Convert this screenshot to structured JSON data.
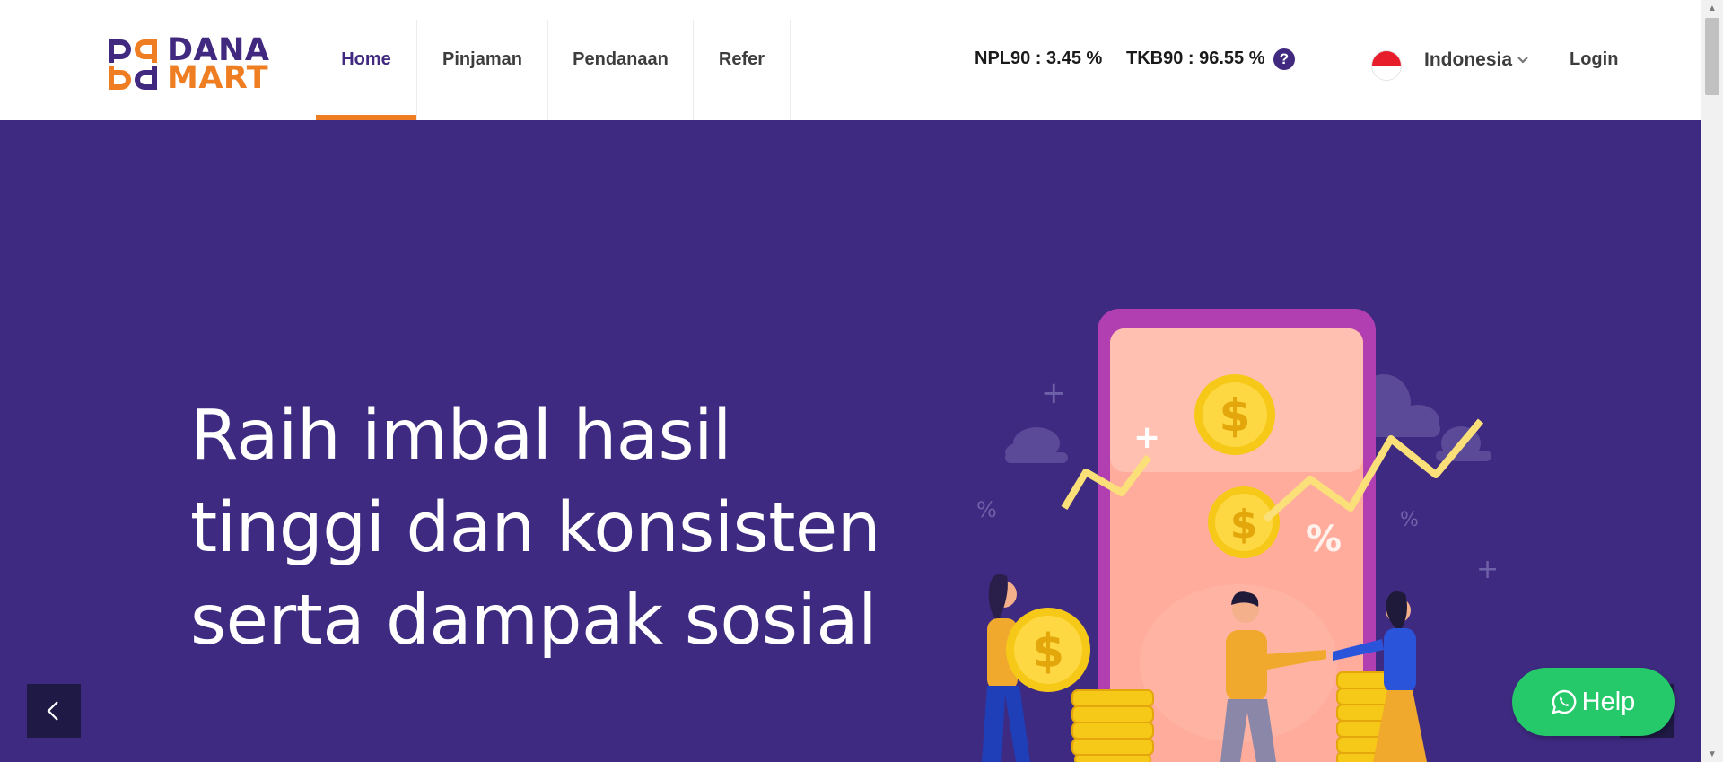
{
  "brand": {
    "name_line1": "DANA",
    "name_line2": "MART",
    "primary": "#40297f",
    "accent": "#ef7d22"
  },
  "nav": {
    "items": [
      {
        "label": "Home",
        "active": true
      },
      {
        "label": "Pinjaman",
        "active": false
      },
      {
        "label": "Pendanaan",
        "active": false
      },
      {
        "label": "Refer",
        "active": false
      }
    ]
  },
  "stats": {
    "npl": "NPL90 : 3.45 %",
    "tkb": "TKB90 : 96.55 %",
    "help_icon": "question-circle-icon"
  },
  "language": {
    "selected": "Indonesia",
    "flag": "indonesia-flag-icon"
  },
  "login_label": "Login",
  "hero": {
    "headline": [
      "Raih imbal hasil",
      "tinggi dan konsisten",
      "serta dampak sosial"
    ],
    "background": "#3e2a80",
    "illustration_marks": {
      "percent_a": "%",
      "percent_b": "%",
      "percent_c": "%",
      "plus": "+",
      "currency": "$"
    }
  },
  "carousel": {
    "prev_icon": "chevron-left-icon",
    "next_icon": "chevron-right-icon"
  },
  "help_button": {
    "label": "Help",
    "icon": "whatsapp-icon",
    "color": "#25c96a"
  }
}
